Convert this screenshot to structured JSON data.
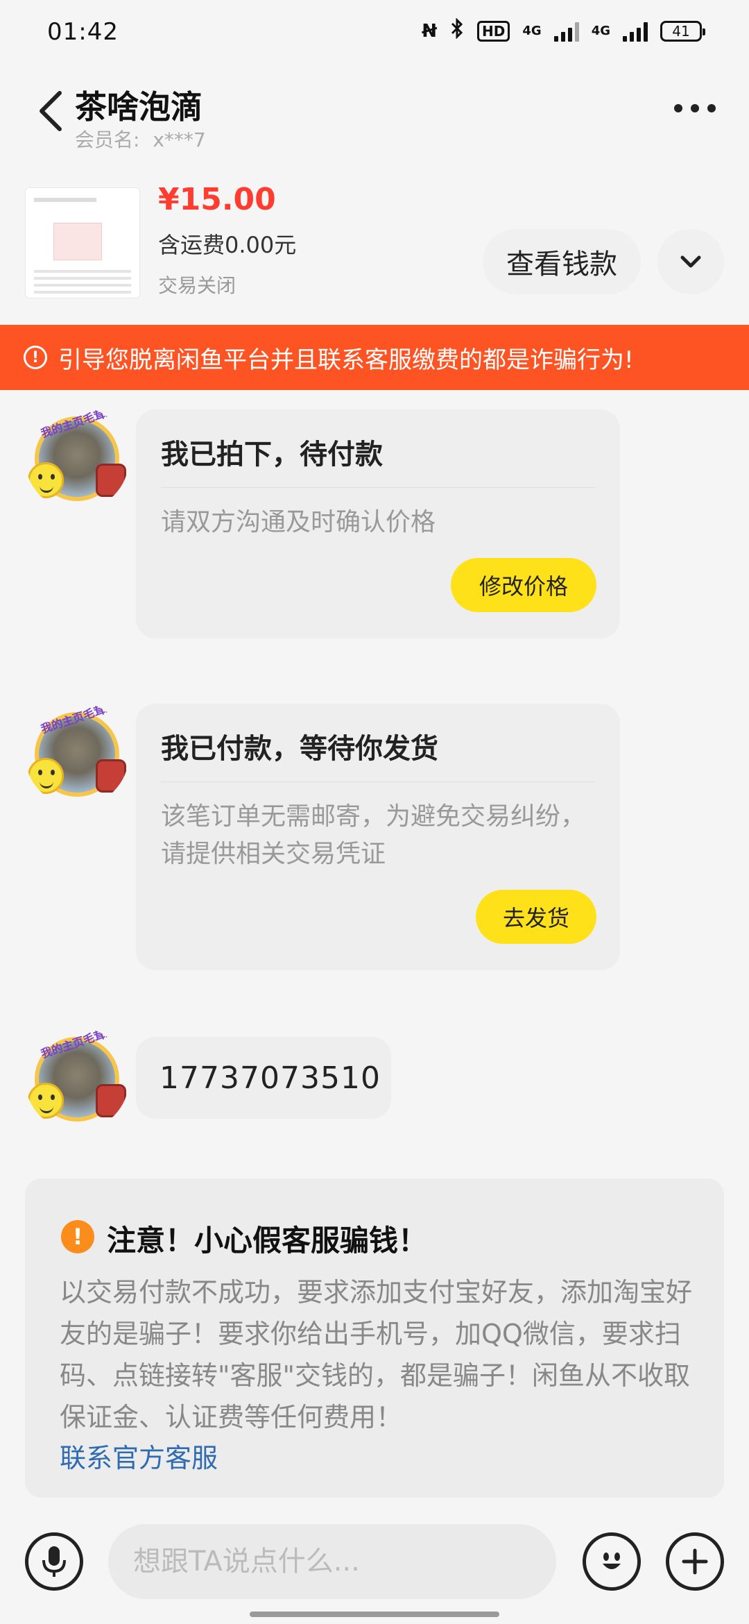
{
  "status_bar": {
    "time": "01:42",
    "network_1": "4G",
    "network_2": "4G",
    "battery": "41"
  },
  "header": {
    "title": "茶啥泡滴",
    "member_prefix": "会员名:",
    "member_name": "x***7"
  },
  "product": {
    "price": "¥15.00",
    "shipping": "含运费0.00元",
    "trade_status": "交易关闭",
    "view_money_label": "查看钱款"
  },
  "warning_banner": {
    "text": "引导您脱离闲鱼平台并且联系客服缴费的都是诈骗行为!"
  },
  "messages": [
    {
      "title": "我已拍下，待付款",
      "desc": "请双方沟通及时确认价格",
      "button": "修改价格"
    },
    {
      "title": "我已付款，等待你发货",
      "desc": "该笔订单无需邮寄，为避免交易纠纷，请提供相关交易凭证",
      "button": "去发货"
    },
    {
      "text": "17737073510"
    }
  ],
  "avatar_caption": "我的主页毛茸茸的",
  "notice": {
    "title": "注意！小心假客服骗钱！",
    "body": "以交易付款不成功，要求添加支付宝好友，添加淘宝好友的是骗子！要求你给出手机号，加QQ微信，要求扫码、点链接转\"客服\"交钱的，都是骗子！闲鱼从不收取保证金、认证费等任何费用！",
    "link": "联系官方客服"
  },
  "input": {
    "placeholder": "想跟TA说点什么..."
  },
  "colors": {
    "price_red": "#ff3c30",
    "banner_orange": "#fe5322",
    "button_yellow": "#ffe11a",
    "link_blue": "#2e6bb1",
    "notice_orange": "#fc8c1c"
  }
}
